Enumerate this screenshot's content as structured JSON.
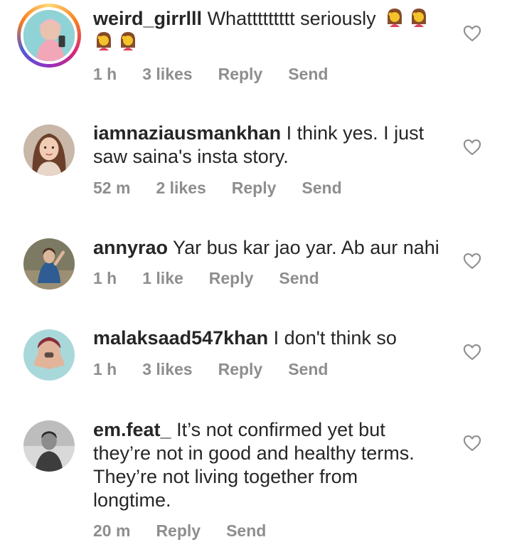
{
  "comments": [
    {
      "username": "weird_girrlll",
      "text": " Whattttttttt seriously",
      "emoji_count": 4,
      "emoji_icon": "face-palm-woman-emoji",
      "time": "1 h",
      "likes": "3 likes",
      "reply": "Reply",
      "send": "Send",
      "has_story_ring": true
    },
    {
      "username": "iamnaziausmankhan",
      "text": " I think yes. I just saw saina's insta story.",
      "time": "52 m",
      "likes": "2 likes",
      "reply": "Reply",
      "send": "Send"
    },
    {
      "username": "annyrao",
      "text": " Yar bus kar jao yar. Ab aur nahi",
      "time": "1 h",
      "likes": "1 like",
      "reply": "Reply",
      "send": "Send"
    },
    {
      "username": "malaksaad547khan",
      "text": " I don't think so",
      "time": "1 h",
      "likes": "3 likes",
      "reply": "Reply",
      "send": "Send"
    },
    {
      "username": "em.feat_",
      "text": " It’s not confirmed yet but they’re not in good and healthy terms. They’re not living together from longtime.",
      "time": "20 m",
      "reply": "Reply",
      "send": "Send"
    }
  ],
  "icons": {
    "like": "heart-outline-icon"
  },
  "colors": {
    "text": "#262626",
    "meta": "#8e8e8e"
  }
}
